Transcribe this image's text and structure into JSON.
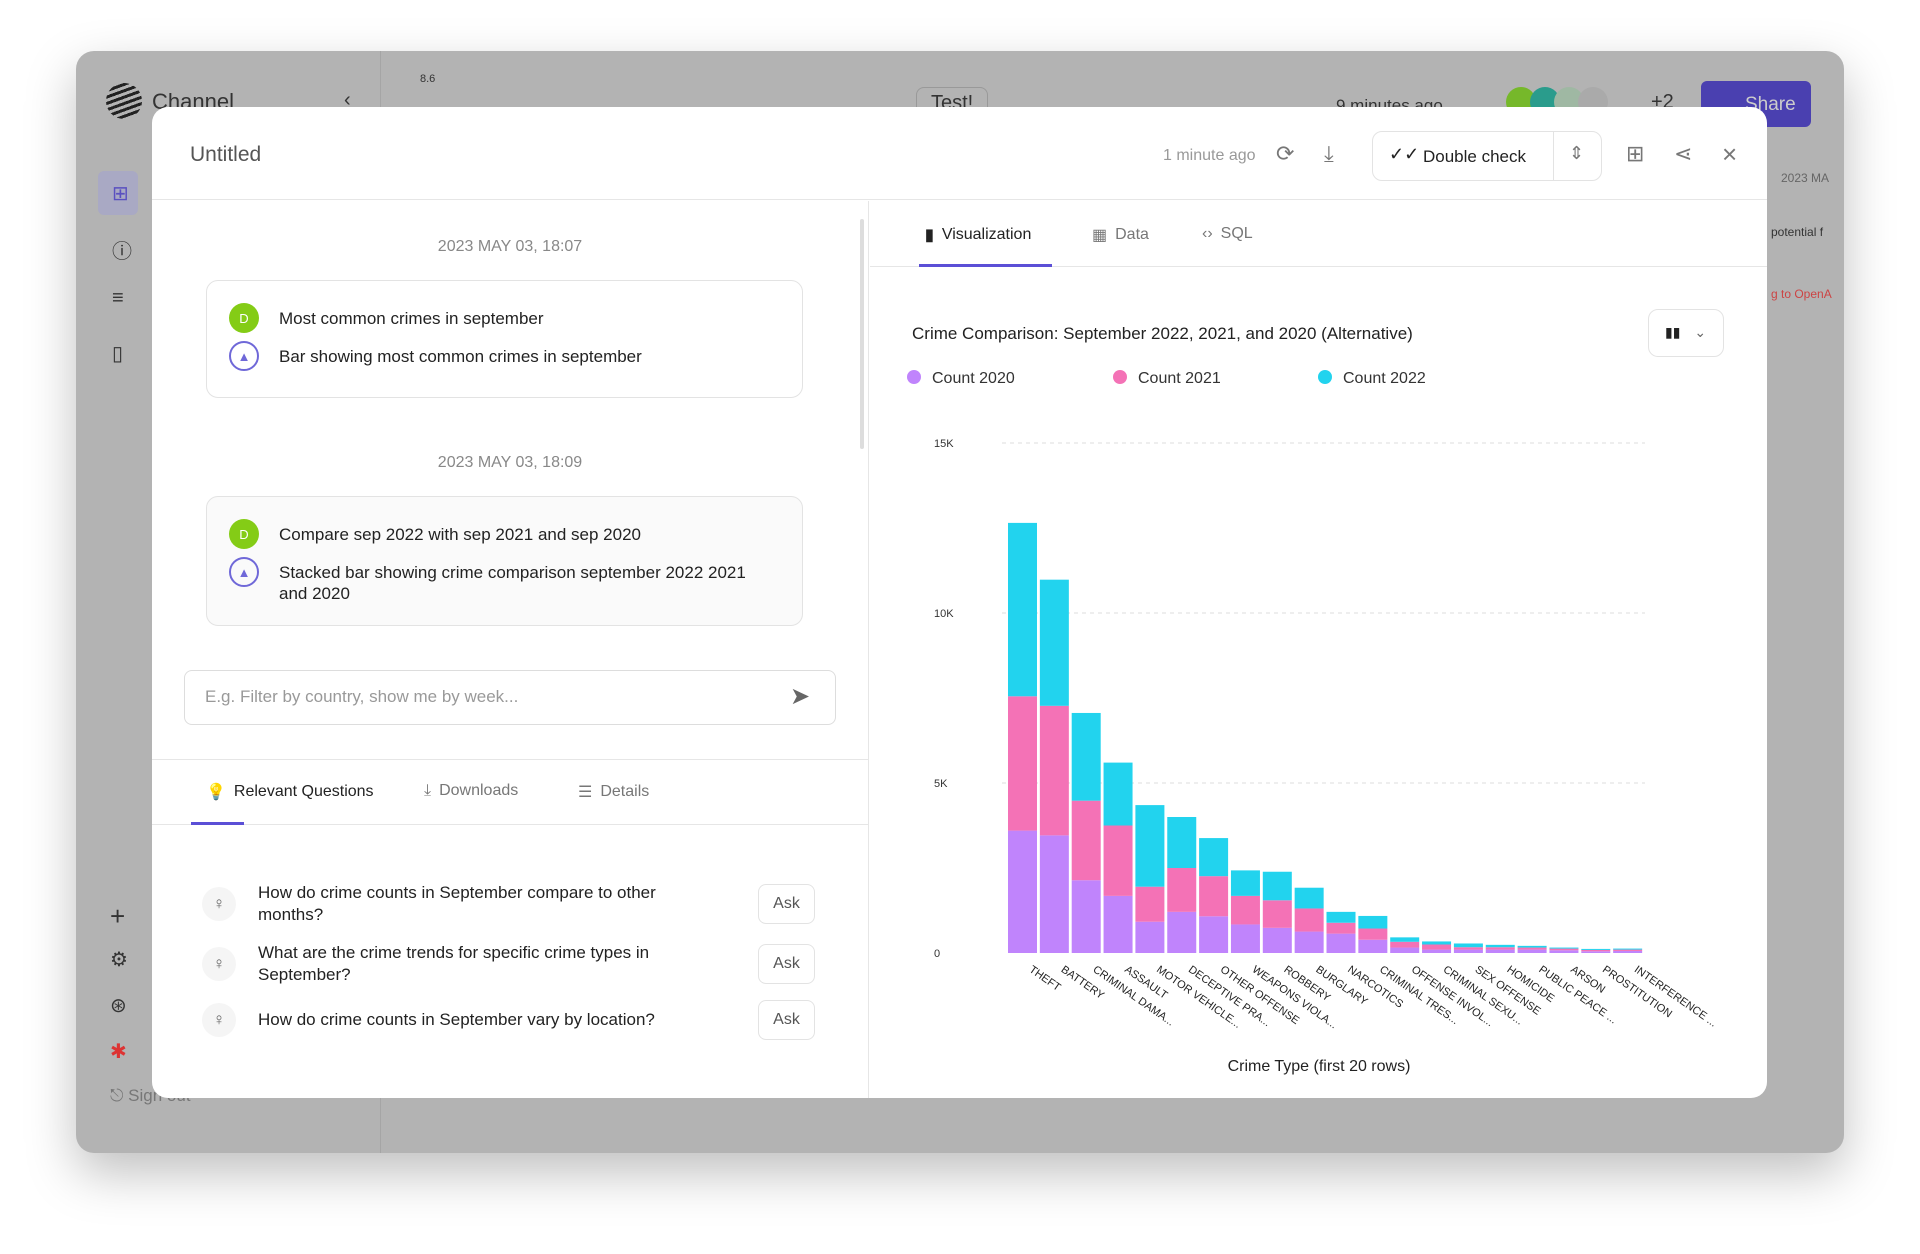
{
  "background": {
    "app_name": "Channel",
    "cell_value": "8.6",
    "test_label": "Test!",
    "updated": "9 minutes ago",
    "extra_users": "+2",
    "share_label": "Share",
    "side_date": "2023 MA",
    "side_text1": "potential f",
    "side_text2": "g to OpenA",
    "sign_out": "Sign out"
  },
  "modal": {
    "title": "Untitled",
    "updated": "1 minute ago",
    "double_check_label": "Double check"
  },
  "conversation": [
    {
      "timestamp": "2023 MAY 03, 18:07",
      "user_initial": "D",
      "question": "Most common crimes in september",
      "answer": "Bar showing most common crimes in september"
    },
    {
      "timestamp": "2023 MAY 03, 18:09",
      "user_initial": "D",
      "question": "Compare sep 2022 with sep 2021 and sep 2020",
      "answer": "Stacked bar showing crime comparison september 2022 2021 and 2020"
    }
  ],
  "input": {
    "placeholder": "E.g. Filter by country, show me by week..."
  },
  "bottom_tabs": [
    {
      "label": "Relevant Questions",
      "icon": "lightbulb-icon"
    },
    {
      "label": "Downloads",
      "icon": "download-icon"
    },
    {
      "label": "Details",
      "icon": "list-icon"
    }
  ],
  "relevant_questions": [
    {
      "text": "How do crime counts in September compare to other months?",
      "button": "Ask"
    },
    {
      "text": "What are the crime trends for specific crime types in September?",
      "button": "Ask"
    },
    {
      "text": "How do crime counts in September vary by location?",
      "button": "Ask"
    }
  ],
  "view_tabs": [
    {
      "label": "Visualization",
      "icon": "bar-chart-icon"
    },
    {
      "label": "Data",
      "icon": "table-icon"
    },
    {
      "label": "SQL",
      "icon": "code-icon"
    }
  ],
  "colors": {
    "accent": "#5b4fd6",
    "count_2020": "#c084fc",
    "count_2021": "#f472b6",
    "count_2022": "#22d3ee"
  },
  "chart_data": {
    "type": "bar",
    "stacked": true,
    "title": "Crime Comparison: September 2022, 2021, and 2020 (Alternative)",
    "xlabel": "Crime Type (first 20 rows)",
    "ylabel": "",
    "ylim": [
      0,
      15000
    ],
    "yticks": [
      0,
      5000,
      10000,
      15000
    ],
    "ytick_labels": [
      "0",
      "5K",
      "10K",
      "15K"
    ],
    "grid": true,
    "legend_position": "top-left",
    "categories": [
      "THEFT",
      "BATTERY",
      "CRIMINAL DAMA...",
      "ASSAULT",
      "MOTOR VEHICLE...",
      "DECEPTIVE PRA...",
      "OTHER OFFENSE",
      "WEAPONS VIOLA...",
      "ROBBERY",
      "BURGLARY",
      "NARCOTICS",
      "CRIMINAL TRES...",
      "OFFENSE INVOL...",
      "CRIMINAL SEXU...",
      "SEX OFFENSE",
      "HOMICIDE",
      "PUBLIC PEACE ...",
      "ARSON",
      "PROSTITUTION",
      "INTERFERENCE ..."
    ],
    "series": [
      {
        "name": "Count 2020",
        "values": [
          3600,
          3460,
          2140,
          1680,
          920,
          1210,
          1080,
          840,
          740,
          630,
          570,
          390,
          160,
          100,
          100,
          100,
          100,
          80,
          50,
          60
        ]
      },
      {
        "name": "Count 2021",
        "values": [
          3950,
          3810,
          2340,
          2070,
          1030,
          1290,
          1180,
          840,
          810,
          680,
          320,
          330,
          170,
          150,
          70,
          70,
          60,
          50,
          40,
          40
        ]
      },
      {
        "name": "Count 2022",
        "values": [
          5100,
          3710,
          2580,
          1850,
          2400,
          1500,
          1120,
          750,
          840,
          610,
          320,
          370,
          130,
          90,
          110,
          70,
          50,
          30,
          30,
          30
        ]
      }
    ]
  }
}
